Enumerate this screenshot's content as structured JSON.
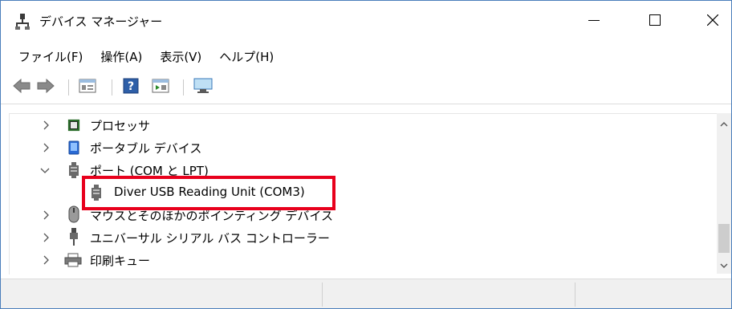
{
  "window": {
    "title": "デバイス マネージャー",
    "icons": {
      "app": "device-manager-icon",
      "minimize": "minimize-icon",
      "maximize": "maximize-icon",
      "close": "close-icon"
    }
  },
  "menu": [
    {
      "label": "ファイル(F)"
    },
    {
      "label": "操作(A)"
    },
    {
      "label": "表示(V)"
    },
    {
      "label": "ヘルプ(H)"
    }
  ],
  "toolbar": [
    {
      "icon": "back-arrow-icon"
    },
    {
      "icon": "forward-arrow-icon"
    },
    {
      "icon": "properties-icon"
    },
    {
      "icon": "help-icon"
    },
    {
      "icon": "show-hidden-icon"
    },
    {
      "icon": "scan-hardware-icon"
    }
  ],
  "tree": [
    {
      "label": "プロセッサ",
      "expander": "collapsed",
      "icon": "processor-icon"
    },
    {
      "label": "ポータブル デバイス",
      "expander": "collapsed",
      "icon": "portable-device-icon"
    },
    {
      "label": "ポート (COM と LPT)",
      "expander": "expanded",
      "icon": "port-icon"
    },
    {
      "label": "Diver USB Reading Unit (COM3)",
      "expander": "none",
      "icon": "port-icon",
      "highlighted": true
    },
    {
      "label": "マウスとそのほかのポインティング デバイス",
      "expander": "collapsed",
      "icon": "mouse-icon"
    },
    {
      "label": "ユニバーサル シリアル バス コントローラー",
      "expander": "collapsed",
      "icon": "usb-icon"
    },
    {
      "label": "印刷キュー",
      "expander": "collapsed",
      "icon": "printer-icon"
    }
  ],
  "colors": {
    "highlight_border": "#e8001c",
    "window_border": "#4a7ebb",
    "statusbar": "#f0f0f0"
  }
}
